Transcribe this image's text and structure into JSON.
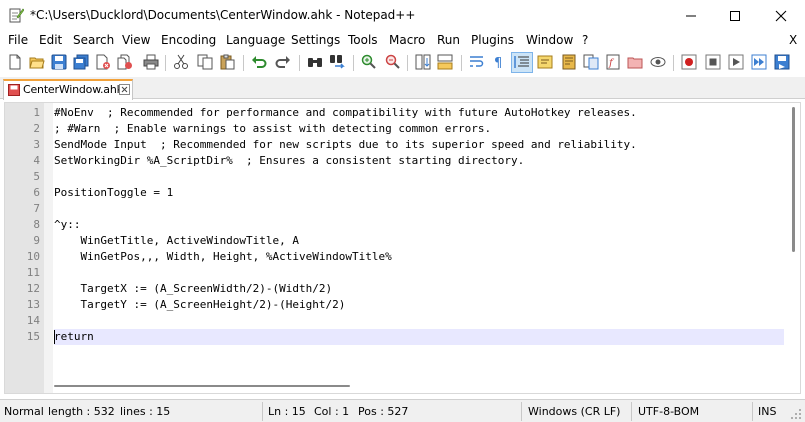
{
  "window": {
    "title": "*C:\\Users\\Ducklord\\Documents\\CenterWindow.ahk - Notepad++"
  },
  "menu": {
    "items": [
      "File",
      "Edit",
      "Search",
      "View",
      "Encoding",
      "Language",
      "Settings",
      "Tools",
      "Macro",
      "Run",
      "Plugins",
      "Window",
      "?"
    ],
    "close_label": "X"
  },
  "toolbar": {
    "icons": [
      "new-file-icon",
      "open-file-icon",
      "save-icon",
      "save-all-icon",
      "close-icon",
      "close-all-icon",
      "print-icon",
      "cut-icon",
      "copy-icon",
      "paste-icon",
      "undo-icon",
      "redo-icon",
      "find-icon",
      "replace-icon",
      "zoom-in-icon",
      "zoom-out-icon",
      "sync-vertical-icon",
      "sync-horizontal-icon",
      "word-wrap-icon",
      "show-all-characters-icon",
      "indent-guide-icon",
      "language-icon",
      "document-map-icon",
      "document-list-icon",
      "function-list-icon",
      "folder-workspace-icon",
      "monitoring-icon",
      "record-macro-icon",
      "stop-macro-icon",
      "playback-macro-icon",
      "run-macro-multiple-icon",
      "save-macro-icon"
    ]
  },
  "tabs": [
    {
      "label": "CenterWindow.ahk",
      "active": true
    }
  ],
  "editor": {
    "current_line": 15,
    "lines": [
      {
        "num": "1",
        "text": "#NoEnv  ; Recommended for performance and compatibility with future AutoHotkey releases."
      },
      {
        "num": "2",
        "text": "; #Warn  ; Enable warnings to assist with detecting common errors."
      },
      {
        "num": "3",
        "text": "SendMode Input  ; Recommended for new scripts due to its superior speed and reliability."
      },
      {
        "num": "4",
        "text": "SetWorkingDir %A_ScriptDir%  ; Ensures a consistent starting directory."
      },
      {
        "num": "5",
        "text": ""
      },
      {
        "num": "6",
        "text": "PositionToggle = 1"
      },
      {
        "num": "7",
        "text": ""
      },
      {
        "num": "8",
        "text": "^y::"
      },
      {
        "num": "9",
        "text": "    WinGetTitle, ActiveWindowTitle, A"
      },
      {
        "num": "10",
        "text": "    WinGetPos,,, Width, Height, %ActiveWindowTitle%"
      },
      {
        "num": "11",
        "text": ""
      },
      {
        "num": "12",
        "text": "    TargetX := (A_ScreenWidth/2)-(Width/2)"
      },
      {
        "num": "13",
        "text": "    TargetY := (A_ScreenHeight/2)-(Height/2)"
      },
      {
        "num": "14",
        "text": ""
      },
      {
        "num": "15",
        "text": "return"
      }
    ]
  },
  "status": {
    "type": "Normal",
    "length": "length : 532",
    "lines": "lines : 15",
    "ln": "Ln : 15",
    "col": "Col : 1",
    "pos": "Pos : 527",
    "eol": "Windows (CR LF)",
    "encoding": "UTF-8-BOM",
    "mode": "INS"
  },
  "colors": {
    "current_line_bg": "#e8e8ff",
    "tab_accent": "#f2a23a",
    "gutter_bg": "#e4e4e4"
  }
}
